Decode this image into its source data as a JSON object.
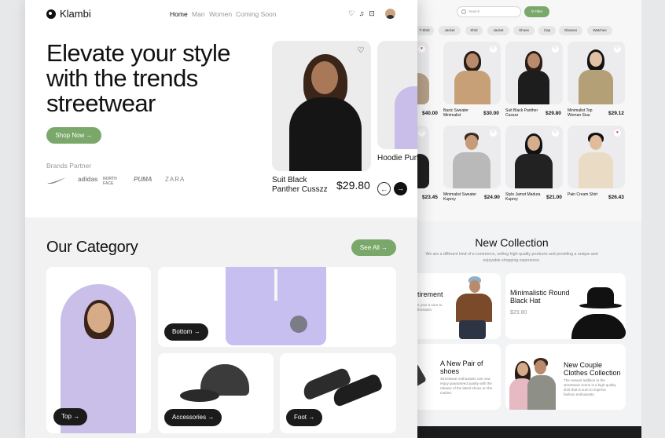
{
  "app": {
    "logo_text": "Klambi"
  },
  "nav": {
    "items": [
      "Home",
      "Man",
      "Women",
      "Coming Soon"
    ]
  },
  "hero": {
    "headline": "Elevate your style with the trends streetwear",
    "shop_button": "Shop Now →",
    "brands_label": "Brands Partner",
    "brands": [
      "adidas",
      "NORTH FACE",
      "PUMA",
      "ZARA"
    ],
    "featured": [
      {
        "name": "Suit Black Panther Cusszz",
        "price": "$29.80"
      },
      {
        "name": "Hoodie Pun Sweetie",
        "price": ""
      }
    ]
  },
  "category": {
    "title": "Our Category",
    "see_all": "See All →",
    "items": [
      "Top →",
      "Bottom →",
      "Accessories →",
      "Foot →"
    ]
  },
  "shop": {
    "search_placeholder": "Search",
    "filter_label": "Filter",
    "chips": [
      "T-Shirt",
      "Jacket",
      "Shirt",
      "Jacket",
      "Shoes",
      "Cap",
      "Glasses",
      "Watches"
    ],
    "products": [
      {
        "name": "",
        "price": "$40.00"
      },
      {
        "name": "Basic Sweater Minimalist",
        "price": "$30.00"
      },
      {
        "name": "Suit Black Panther Cusszz",
        "price": "$29.80"
      },
      {
        "name": "Minimalist Top Woman Siuu",
        "price": "$29.12"
      },
      {
        "name": "",
        "price": "$23.45"
      },
      {
        "name": "Minimalist Sweater Kuproy",
        "price": "$24.90"
      },
      {
        "name": "Style Jamet Madura Kuproy",
        "price": "$21.00"
      },
      {
        "name": "Pain Cream Shirt",
        "price": "$26.43"
      }
    ]
  },
  "new_collection": {
    "title": "New Collection",
    "subtitle": "We are a different kind of e-commerce, selling high-quality products and providing a unique and enjoyable shopping experience.",
    "cards": [
      {
        "title": "etirement",
        "desc": "ade your a sure to enthusiasts."
      },
      {
        "title": "Minimalistic Round Black Hat",
        "price": "$29.80"
      },
      {
        "title": "A New Pair of shoes",
        "desc": "Streetwear enthusiasts can now enjoy guaranteed quality with the release of the latest shoes on the market."
      },
      {
        "title": "New Couple Clothes Collection",
        "desc": "The newest addition to the streetwear scene is a high-quality shirt that is sure to impress fashion enthusiasts."
      }
    ]
  },
  "colors": {
    "accent": "#7aa86a",
    "dark": "#1b1b1b",
    "heart_red": "#d33333"
  },
  "icons": [
    "heart-icon",
    "bell-icon",
    "bag-icon",
    "search-icon",
    "filter-icon",
    "nike-logo-icon"
  ]
}
